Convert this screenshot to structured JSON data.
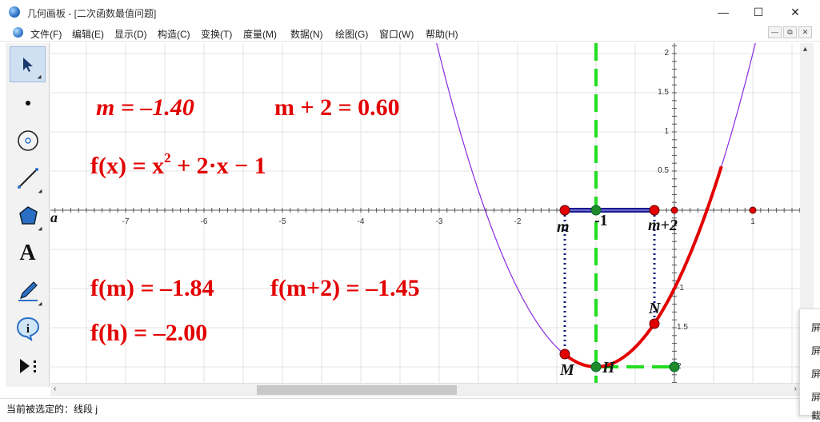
{
  "window": {
    "title": "几何画板 - [二次函数最值问题]",
    "minimize_glyph": "—",
    "maximize_glyph": "☐",
    "close_glyph": "✕"
  },
  "menubar": {
    "items": [
      "文件(F)",
      "编辑(E)",
      "显示(D)",
      "构造(C)",
      "变换(T)",
      "度量(M)",
      "数据(N)",
      "绘图(G)",
      "窗口(W)",
      "帮助(H)"
    ],
    "mdi": [
      "—",
      "⧉",
      "✕"
    ]
  },
  "toolbox": {
    "tools": [
      "arrow-tool",
      "point-tool",
      "compass-tool",
      "straightedge-tool",
      "polygon-tool",
      "text-tool",
      "marker-tool",
      "information-tool",
      "custom-tool"
    ],
    "text_tool_glyph": "A"
  },
  "axes": {
    "x_ticks": [
      "-7",
      "-6",
      "-5",
      "-4",
      "-3",
      "-2",
      "1"
    ],
    "y_ticks": [
      "2",
      "1.5",
      "1",
      "0.5",
      "-1",
      "1.5",
      "2"
    ],
    "origin_label": "a"
  },
  "measurements": {
    "m": "m = –1.40",
    "m_plus_2": "m + 2 = 0.60",
    "f_def_left": "f(x) = x",
    "f_def_sup": "2",
    "f_def_right": " + 2·x − 1",
    "f_m": "f(m) = –1.84",
    "f_m2": "f(m+2) = –1.45",
    "f_h": "f(h) = –2.00"
  },
  "point_labels": {
    "m": "m",
    "neg1": "-1",
    "m2": "m+2",
    "M": "M",
    "H": "H",
    "N": "N"
  },
  "chart_data": {
    "type": "line",
    "function": "f(x) = x^2 + 2x - 1",
    "m": -1.4,
    "m_plus_2": 0.6,
    "f_m": -1.84,
    "f_m2": -1.45,
    "f_h": -2.0,
    "axis_of_symmetry": -1
  },
  "statusbar": {
    "text": "当前被选定的：线段 j"
  },
  "popup": {
    "items": [
      "屏",
      "屏",
      "屏",
      "屏",
      "截"
    ]
  },
  "colors": {
    "accent_red": "#e30000",
    "dash_green": "#22dd22",
    "segment_blue": "#1a1a8c",
    "curve_purple": "#8a2be2",
    "dot_navy": "#0b1a7a"
  }
}
